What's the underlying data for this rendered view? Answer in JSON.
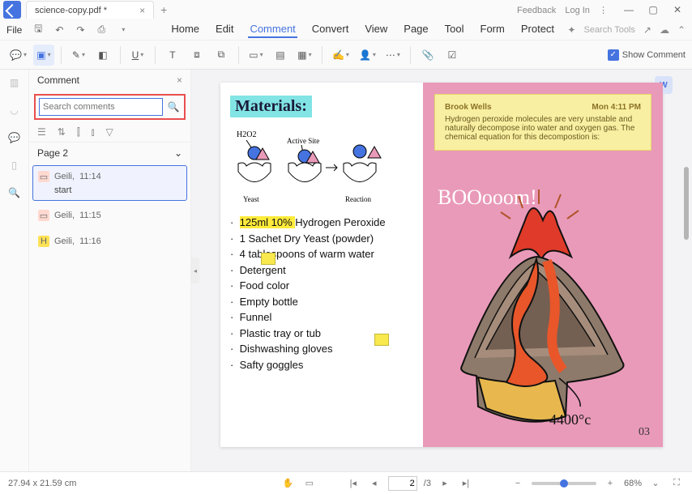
{
  "titlebar": {
    "document_name": "science-copy.pdf *",
    "feedback": "Feedback",
    "login": "Log In"
  },
  "menu": {
    "file": "File",
    "tabs": [
      "Home",
      "Edit",
      "Comment",
      "Convert",
      "View",
      "Page",
      "Tool",
      "Form",
      "Protect"
    ],
    "active": 2,
    "search_tools": "Search Tools"
  },
  "toolbar": {
    "show_comment": "Show Comment"
  },
  "comment_panel": {
    "title": "Comment",
    "search_placeholder": "Search comments",
    "page_label": "Page 2",
    "items": [
      {
        "author": "Geili,",
        "time": "11:14",
        "text": "start",
        "icon_bg": "#ffd9d0",
        "icon": "▭"
      },
      {
        "author": "Geili,",
        "time": "11:15",
        "text": "",
        "icon_bg": "#ffd9d0",
        "icon": "▭"
      },
      {
        "author": "Geili,",
        "time": "11:16",
        "text": "",
        "icon_bg": "#ffe156",
        "icon": "H"
      }
    ]
  },
  "doc": {
    "heading": "Materials:",
    "diagram_labels": {
      "h2o2": "H2O2",
      "active_site": "Active Site",
      "yeast": "Yeast",
      "reaction": "Reaction"
    },
    "list": [
      {
        "text": "125ml 10% ",
        "hl": true,
        "rest": "Hydrogen Peroxide"
      },
      {
        "text": "1 Sachet Dry Yeast (powder)"
      },
      {
        "text": "4 tablespoons of warm water"
      },
      {
        "text": "Detergent"
      },
      {
        "text": "Food color"
      },
      {
        "text": "Empty bottle"
      },
      {
        "text": "Funnel"
      },
      {
        "text": "Plastic tray or tub"
      },
      {
        "text": "Dishwashing gloves"
      },
      {
        "text": "Safty goggles"
      }
    ],
    "note": {
      "author": "Brook Wells",
      "time": "Mon 4:11 PM",
      "body": "Hydrogen peroxide molecules are very unstable and naturally decompose into water and oxygen gas. The chemical equation for this decompostion is:"
    },
    "boom": "BOOooom!",
    "temp": "4400°c",
    "page_number": "03"
  },
  "status": {
    "dimensions": "27.94 x 21.59 cm",
    "page_current": "2",
    "page_total": "/3",
    "zoom": "68%"
  }
}
